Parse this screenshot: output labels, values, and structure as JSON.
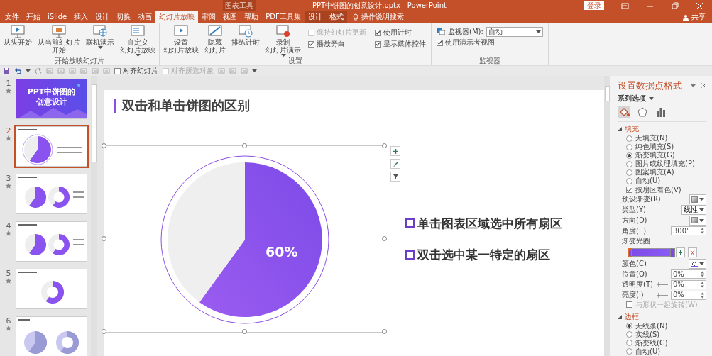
{
  "window": {
    "context_label": "图表工具",
    "title": "PPT中饼图的创意设计.pptx - PowerPoint",
    "sign_in": "登录"
  },
  "tabs": [
    {
      "label": "文件",
      "selected": false,
      "contextual": false
    },
    {
      "label": "开始",
      "selected": false,
      "contextual": false
    },
    {
      "label": "iSlide",
      "selected": false,
      "contextual": false
    },
    {
      "label": "插入",
      "selected": false,
      "contextual": false
    },
    {
      "label": "设计",
      "selected": false,
      "contextual": false
    },
    {
      "label": "切换",
      "selected": false,
      "contextual": false
    },
    {
      "label": "动画",
      "selected": false,
      "contextual": false
    },
    {
      "label": "幻灯片放映",
      "selected": true,
      "contextual": false
    },
    {
      "label": "审阅",
      "selected": false,
      "contextual": false
    },
    {
      "label": "视图",
      "selected": false,
      "contextual": false
    },
    {
      "label": "帮助",
      "selected": false,
      "contextual": false
    },
    {
      "label": "PDF工具集",
      "selected": false,
      "contextual": false
    },
    {
      "label": "设计",
      "selected": false,
      "contextual": true
    },
    {
      "label": "格式",
      "selected": false,
      "contextual": true
    }
  ],
  "tell_me": "操作说明搜索",
  "share": "共享",
  "ribbon": [
    {
      "label": "开始放映幻灯片",
      "items": [
        {
          "kind": "large",
          "lines": [
            "从头开始"
          ],
          "dropdown": false
        },
        {
          "kind": "large",
          "lines": [
            "从当前幻灯片",
            "开始"
          ],
          "dropdown": false
        },
        {
          "kind": "large",
          "lines": [
            "联机演示"
          ],
          "dropdown": true
        },
        {
          "kind": "large",
          "lines": [
            "自定义",
            "幻灯片放映"
          ],
          "dropdown": true
        }
      ]
    },
    {
      "label": "设置",
      "items": [
        {
          "kind": "large",
          "lines": [
            "设置",
            "幻灯片放映"
          ],
          "dropdown": false
        },
        {
          "kind": "large",
          "lines": [
            "隐藏",
            "幻灯片"
          ],
          "dropdown": false
        },
        {
          "kind": "large",
          "lines": [
            "排练计时"
          ],
          "dropdown": false
        },
        {
          "kind": "large",
          "lines": [
            "录制",
            "幻灯片演示"
          ],
          "dropdown": true
        },
        {
          "kind": "stack",
          "items": [
            {
              "kind": "check",
              "label": "保持幻灯片更新",
              "checked": false,
              "disabled": true
            },
            {
              "kind": "check",
              "label": "播放旁白",
              "checked": true,
              "disabled": false
            }
          ]
        },
        {
          "kind": "stack",
          "items": [
            {
              "kind": "check",
              "label": "使用计时",
              "checked": true,
              "disabled": false
            },
            {
              "kind": "check",
              "label": "显示媒体控件",
              "checked": true,
              "disabled": false
            }
          ]
        }
      ]
    },
    {
      "label": "监视器",
      "items": [
        {
          "kind": "stack",
          "items": [
            {
              "kind": "select",
              "label": "监视器(M):",
              "value": "自动"
            },
            {
              "kind": "check",
              "label": "使用演示者视图",
              "checked": true,
              "disabled": false
            }
          ]
        }
      ]
    }
  ],
  "quick_access": {
    "checks": [
      {
        "label": "对齐幻灯片",
        "checked": false,
        "disabled": false
      },
      {
        "label": "对齐所选对象",
        "checked": false,
        "disabled": true
      }
    ]
  },
  "slides": [
    {
      "number": "1",
      "selected": false,
      "kind": "title",
      "title_lines": [
        "PPT中饼图的",
        "创意设计"
      ]
    },
    {
      "number": "2",
      "selected": true,
      "kind": "pie_text"
    },
    {
      "number": "3",
      "selected": false,
      "kind": "pie_donut"
    },
    {
      "number": "4",
      "selected": false,
      "kind": "pie_donut"
    },
    {
      "number": "5",
      "selected": false,
      "kind": "donut"
    },
    {
      "number": "6",
      "selected": false,
      "kind": "pale_pie_donut"
    }
  ],
  "slide": {
    "title": "双击和单击饼图的区别",
    "chart_selected": true,
    "chart_data": {
      "type": "pie",
      "values": [
        60,
        40
      ],
      "value_labels": [
        "60%",
        null
      ]
    },
    "bullets": [
      "单击图表区域选中所有扇区",
      "双击选中某一特定的扇区"
    ]
  },
  "pane": {
    "title": "设置数据点格式",
    "options_label": "系列选项",
    "icon_tabs": [
      {
        "kind": "fill",
        "selected": true
      },
      {
        "kind": "effects",
        "selected": false
      },
      {
        "kind": "series",
        "selected": false
      }
    ],
    "sections": [
      {
        "label": "填充",
        "expanded": true,
        "rows": [
          {
            "kind": "radio",
            "label": "无填充(N)",
            "selected": false
          },
          {
            "kind": "radio",
            "label": "纯色填充(S)",
            "selected": false
          },
          {
            "kind": "radio",
            "label": "渐变填充(G)",
            "selected": true
          },
          {
            "kind": "radio",
            "label": "图片或纹理填充(P)",
            "selected": false
          },
          {
            "kind": "radio",
            "label": "图案填充(A)",
            "selected": false
          },
          {
            "kind": "radio",
            "label": "自动(U)",
            "selected": false
          },
          {
            "kind": "check",
            "label": "按扇区着色(V)",
            "checked": true,
            "disabled": false
          },
          {
            "kind": "swatch",
            "label": "预设渐变(R)"
          },
          {
            "kind": "select",
            "label": "类型(Y)",
            "value": "线性"
          },
          {
            "kind": "swatch",
            "label": "方向(D)"
          },
          {
            "kind": "spin",
            "label": "角度(E)",
            "value": "300°",
            "slider": false
          },
          {
            "kind": "gradient",
            "label": "渐变光圈",
            "stops": [
              {
                "level": 0,
                "selected": true
              },
              {
                "level": 1,
                "selected": false
              }
            ]
          },
          {
            "kind": "color",
            "label": "颜色(C)"
          },
          {
            "kind": "spin",
            "label": "位置(O)",
            "value": "0%",
            "slider": false
          },
          {
            "kind": "spin",
            "label": "透明度(T)",
            "value": "0%",
            "slider": true
          },
          {
            "kind": "spin",
            "label": "亮度(I)",
            "value": "0%",
            "slider": true
          },
          {
            "kind": "check",
            "label": "与形状一起旋转(W)",
            "checked": false,
            "disabled": true
          }
        ]
      },
      {
        "label": "边框",
        "expanded": true,
        "rows": [
          {
            "kind": "radio",
            "label": "无线条(N)",
            "selected": true
          },
          {
            "kind": "radio",
            "label": "实线(S)",
            "selected": false
          },
          {
            "kind": "radio",
            "label": "渐变线(G)",
            "selected": false
          },
          {
            "kind": "radio",
            "label": "自动(U)",
            "selected": false
          }
        ]
      }
    ]
  }
}
